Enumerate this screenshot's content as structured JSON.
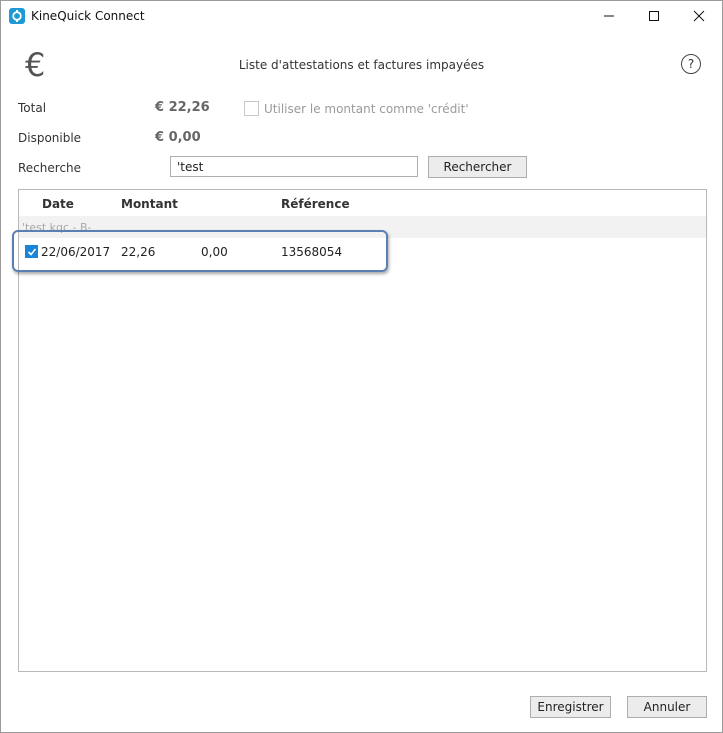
{
  "window": {
    "title": "KineQuick Connect"
  },
  "header": {
    "euro_symbol": "€",
    "title": "Liste d'attestations et factures impayées",
    "help_symbol": "?"
  },
  "summary": {
    "total_label": "Total",
    "total_value": "€ 22,26",
    "credit_label": "Utiliser le montant comme 'crédit'",
    "credit_checked": false,
    "available_label": "Disponible",
    "available_value": "€ 0,00"
  },
  "search": {
    "label": "Recherche",
    "value": "'test",
    "button_label": "Rechercher"
  },
  "table": {
    "columns": [
      "Date",
      "Montant",
      "Référence"
    ],
    "group_label": "'test kqc - B-",
    "rows": [
      {
        "checked": true,
        "date": "22/06/2017",
        "montant": "22,26",
        "paid": "0,00",
        "reference": "13568054"
      }
    ]
  },
  "footer": {
    "save_label": "Enregistrer",
    "cancel_label": "Annuler"
  },
  "colors": {
    "accent": "#1a84d8",
    "highlight_border": "#5b7fb5",
    "app_icon": "#1d9ad6"
  }
}
